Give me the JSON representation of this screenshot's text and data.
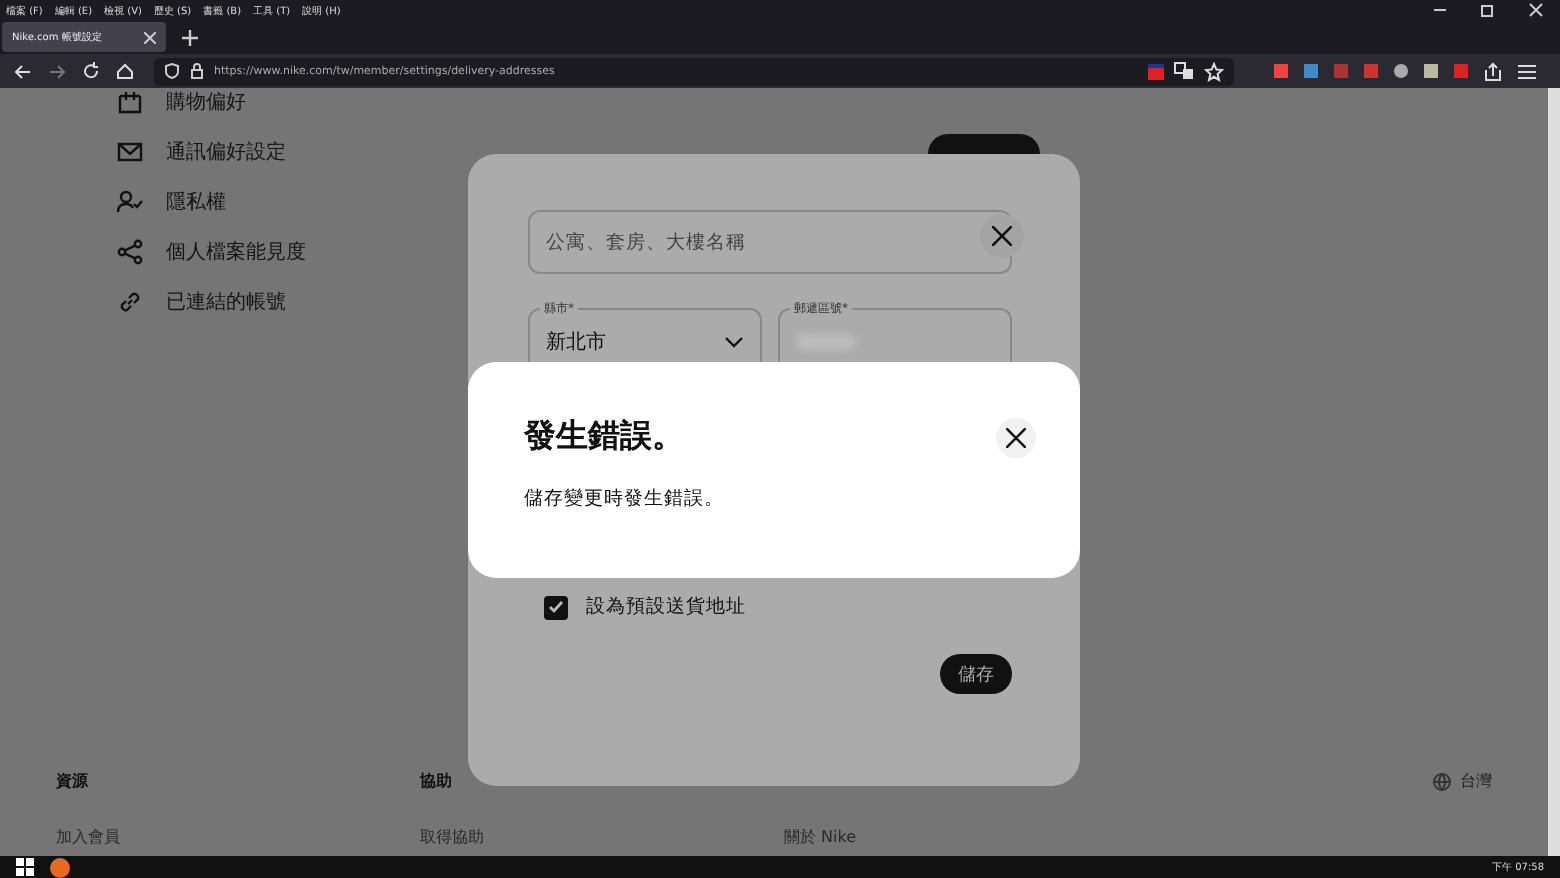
{
  "browser": {
    "menu": [
      "檔案 (F)",
      "編輯 (E)",
      "檢視 (V)",
      "歷史 (S)",
      "書籤 (B)",
      "工具 (T)",
      "說明 (H)"
    ],
    "tab": {
      "title": "Nike.com 帳號設定"
    },
    "url": "https://www.nike.com/tw/member/settings/delivery-addresses"
  },
  "sidebar": {
    "items": [
      {
        "label": "購物偏好"
      },
      {
        "label": "通訊偏好設定"
      },
      {
        "label": "隱私權"
      },
      {
        "label": "個人檔案能見度"
      },
      {
        "label": "已連結的帳號"
      }
    ]
  },
  "address_modal": {
    "address2": {
      "placeholder": "公寓、套房、大樓名稱"
    },
    "city": {
      "label": "縣市*",
      "value": "新北市"
    },
    "postal": {
      "label": "郵遞區號*"
    },
    "default_checkbox": {
      "label": "設為預設送貨地址",
      "checked": true
    },
    "save_button": "儲存"
  },
  "error_dialog": {
    "title": "發生錯誤。",
    "message": "儲存變更時發生錯誤。"
  },
  "footer": {
    "columns": [
      {
        "heading": "資源",
        "link": "加入會員"
      },
      {
        "heading": "協助",
        "link": "取得協助"
      },
      {
        "link": "關於 Nike"
      }
    ],
    "region": "台灣"
  },
  "taskbar": {
    "clock": "下午 07:58"
  }
}
